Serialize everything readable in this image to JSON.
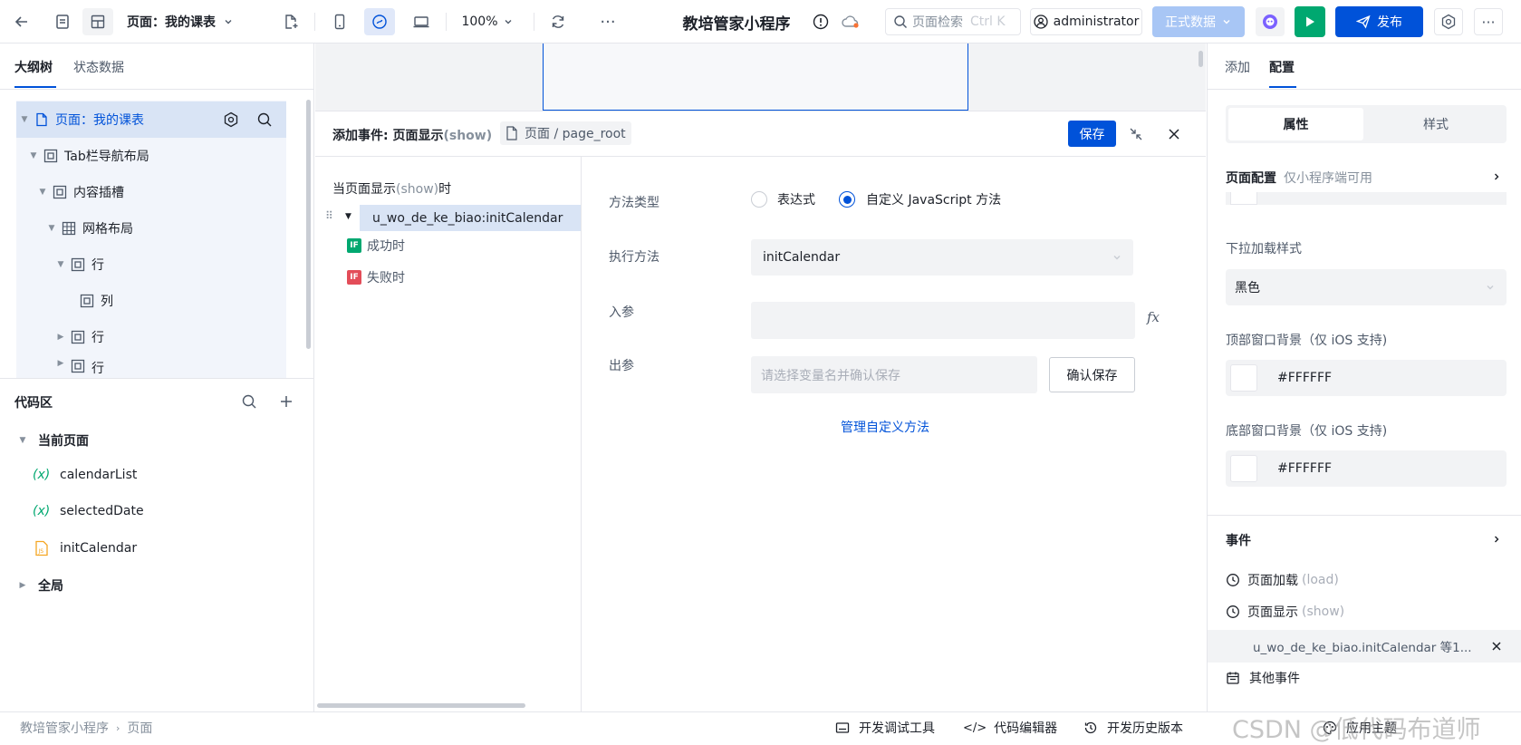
{
  "header": {
    "page_selector": "页面：我的课表",
    "zoom": "100%",
    "app_title": "教培管家小程序",
    "search_placeholder": "页面检索",
    "search_shortcut": "Ctrl K",
    "user": "administrator",
    "env_button": "正式数据",
    "publish_button": "发布"
  },
  "left": {
    "tabs": [
      "大纲树",
      "状态数据"
    ],
    "tree": [
      {
        "label": "页面：我的课表"
      },
      {
        "label": "Tab栏导航布局"
      },
      {
        "label": "内容插槽"
      },
      {
        "label": "网格布局"
      },
      {
        "label": "行"
      },
      {
        "label": "列"
      },
      {
        "label": "行"
      },
      {
        "label": "行"
      }
    ],
    "code_title": "代码区",
    "current_page": "当前页面",
    "code_items": [
      {
        "label": "calendarList",
        "icon": "variable-icon"
      },
      {
        "label": "selectedDate",
        "icon": "variable-icon"
      },
      {
        "label": "initCalendar",
        "icon": "js-file-icon"
      }
    ],
    "global": "全局"
  },
  "event_panel": {
    "title": "添加事件: 页面显示",
    "title_suffix": "(show)",
    "breadcrumb": "页面 / page_root",
    "save": "保存",
    "trigger_prefix": "当页面显示",
    "trigger_show": "(show)",
    "trigger_suffix": "时",
    "action": "u_wo_de_ke_biao:initCalendar",
    "success": "成功时",
    "fail": "失败时",
    "if_badge": "IF",
    "method_type_label": "方法类型",
    "option_expr": "表达式",
    "option_js": "自定义 JavaScript 方法",
    "exec_label": "执行方法",
    "exec_value": "initCalendar",
    "param_label": "入参",
    "fx": "fx",
    "out_label": "出参",
    "out_placeholder": "请选择变量名并确认保存",
    "confirm_save": "确认保存",
    "manage_link": "管理自定义方法"
  },
  "right": {
    "tabs": [
      "添加",
      "配置"
    ],
    "seg": [
      "属性",
      "样式"
    ],
    "page_config": "页面配置",
    "page_config_note": "仅小程序端可用",
    "pulldown_label": "下拉加载样式",
    "pulldown_value": "黑色",
    "top_bg_label": "顶部窗口背景（仅 iOS 支持)",
    "top_bg_value": "#FFFFFF",
    "bottom_bg_label": "底部窗口背景（仅 iOS 支持)",
    "bottom_bg_value": "#FFFFFF",
    "events_title": "事件",
    "ev_load": "页面加载",
    "ev_load_en": "(load)",
    "ev_show": "页面显示",
    "ev_show_en": "(show)",
    "ev_bound": "u_wo_de_ke_biao.initCalendar 等1...",
    "ev_other": "其他事件"
  },
  "footer": {
    "crumbs": [
      "教培管家小程序",
      "页面"
    ],
    "devtools": "开发调试工具",
    "code_editor": "代码编辑器",
    "history": "开发历史版本",
    "theme": "应用主题",
    "watermark": "CSDN @低代码布道师"
  },
  "colors": {
    "primary": "#0052d9",
    "green": "#00a870",
    "selected": "#d9e4f5",
    "if_green": "#00a870",
    "if_red": "#e34d59"
  }
}
